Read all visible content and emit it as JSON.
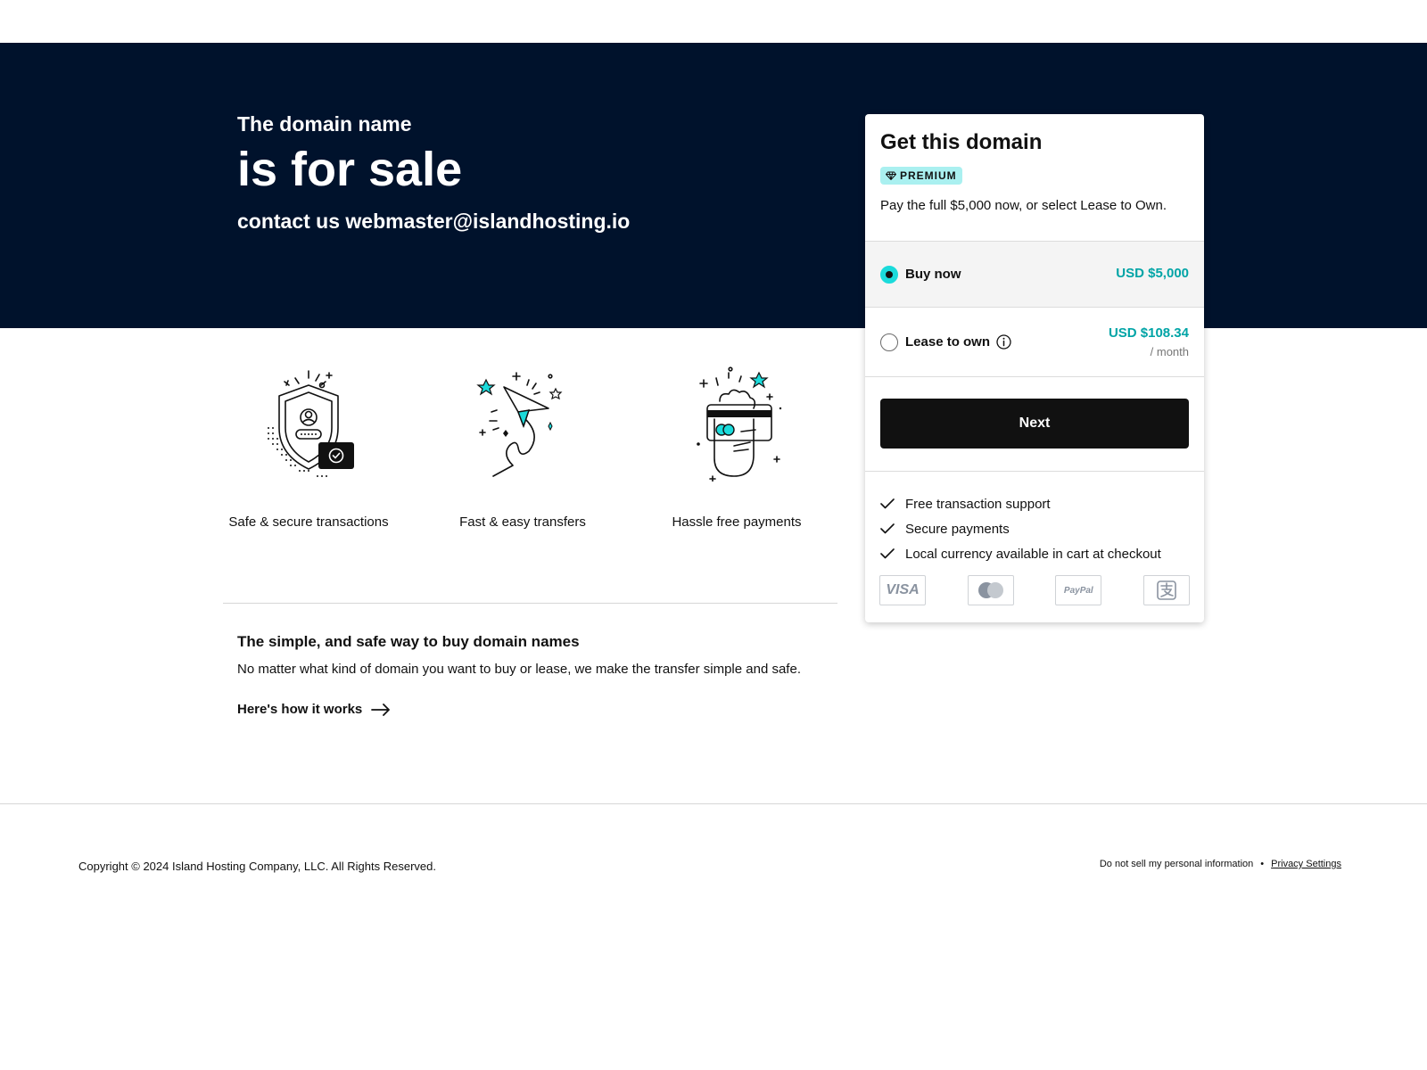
{
  "hero": {
    "subtitle": "The domain name",
    "title": "is for sale",
    "contact": "contact us webmaster@islandhosting.io"
  },
  "features": [
    {
      "label": "Safe & secure transactions",
      "icon": "shield-icon"
    },
    {
      "label": "Fast & easy transfers",
      "icon": "paper-plane-icon"
    },
    {
      "label": "Hassle free payments",
      "icon": "card-hand-icon"
    }
  ],
  "info": {
    "title": "The simple, and safe way to buy domain names",
    "text": "No matter what kind of domain you want to buy or lease, we make the transfer simple and safe.",
    "link": "Here's how it works"
  },
  "card": {
    "title": "Get this domain",
    "badge": "PREMIUM",
    "description": "Pay the full $5,000 now, or select Lease to Own.",
    "options": [
      {
        "label": "Buy now",
        "price": "USD $5,000",
        "selected": true
      },
      {
        "label": "Lease to own",
        "price": "USD $108.34",
        "period": "/ month",
        "selected": false
      }
    ],
    "next_label": "Next",
    "benefits": [
      "Free transaction support",
      "Secure payments",
      "Local currency available in cart at checkout"
    ],
    "payment_methods": [
      "visa-icon",
      "mastercard-icon",
      "paypal-icon",
      "alipay-icon"
    ],
    "payment_text": {
      "visa": "VISA",
      "paypal": "PayPal"
    }
  },
  "footer": {
    "copyright": "Copyright © 2024 Island Hosting Company, LLC. All Rights Reserved.",
    "do_not_sell": "Do not sell my personal information",
    "separator": "•",
    "privacy": "Privacy Settings"
  },
  "colors": {
    "hero_bg": "#00122c",
    "accent": "#1bdbdb",
    "price": "#00a4a6",
    "button": "#111111"
  }
}
